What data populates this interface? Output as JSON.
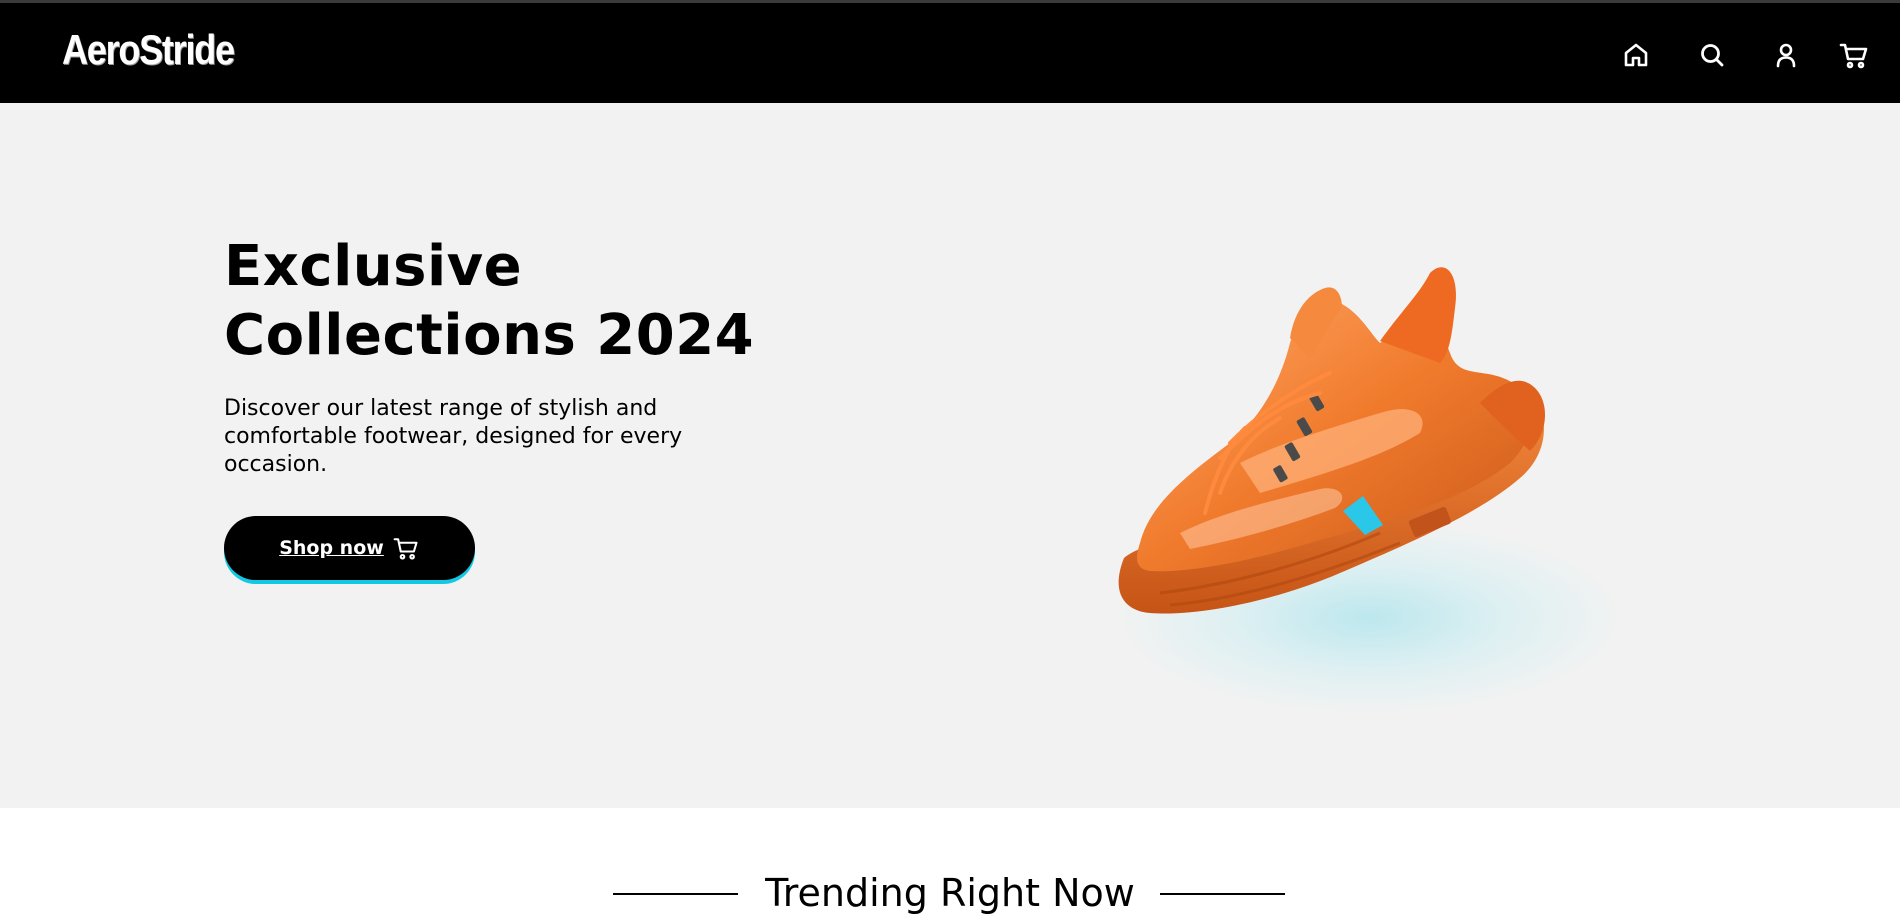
{
  "brand": {
    "name": "AeroStride"
  },
  "nav": {
    "icons": [
      "home-icon",
      "search-icon",
      "account-icon",
      "cart-icon"
    ]
  },
  "hero": {
    "title_line1": "Exclusive",
    "title_line2": "Collections 2024",
    "description": "Discover our latest range of stylish and comfortable footwear, designed for every occasion.",
    "cta_label": "Shop now",
    "cta_icon": "cart-icon",
    "image": "orange-sneaker"
  },
  "trending": {
    "title": "Trending Right Now"
  },
  "colors": {
    "navbar": "#000000",
    "hero_bg": "#f2f2f2",
    "accent": "#12c8e2",
    "shoe": "#f07a2c"
  }
}
